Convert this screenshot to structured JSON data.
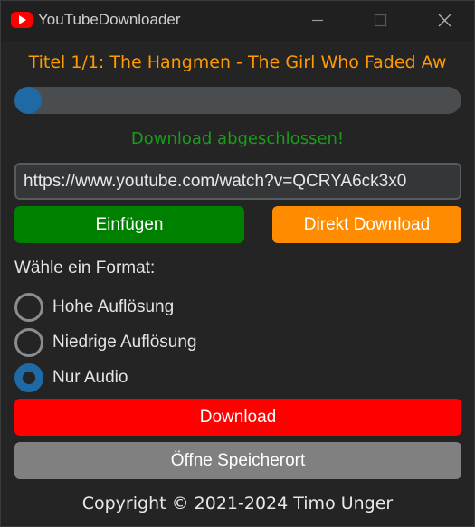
{
  "window": {
    "title": "YouTubeDownloader",
    "icon": "youtube-logo-icon",
    "controls": [
      "minimize-icon",
      "maximize-icon",
      "close-icon"
    ]
  },
  "main": {
    "song_title": "Titel 1/1: The Hangmen - The Girl Who Faded Aw",
    "progress": 0.03,
    "status": "Download abgeschlossen!",
    "url_value": "https://www.youtube.com/watch?v=QCRYA6ck3x0",
    "paste_label": "Einfügen",
    "direct_download_label": "Direkt Download",
    "format_label": "Wähle ein Format:",
    "formats": [
      {
        "label": "Hohe Auflösung",
        "selected": false
      },
      {
        "label": "Niedrige Auflösung",
        "selected": false
      },
      {
        "label": "Nur Audio",
        "selected": true
      }
    ],
    "download_label": "Download",
    "open_location_label": "Öffne Speicherort",
    "copyright": "Copyright © 2021-2024 Timo Unger"
  },
  "colors": {
    "background": "#242424",
    "titlebar": "#202020",
    "title_accent": "#ff9b00",
    "status_green": "#1a9c1a",
    "paste_button": "#008000",
    "direct_button": "#ff8c00",
    "download_button": "#ff0000",
    "open_button": "#808080",
    "progress_fill": "#1f6aa5",
    "progress_track": "#4a4d50",
    "radio_selected": "#1f6aa5"
  }
}
